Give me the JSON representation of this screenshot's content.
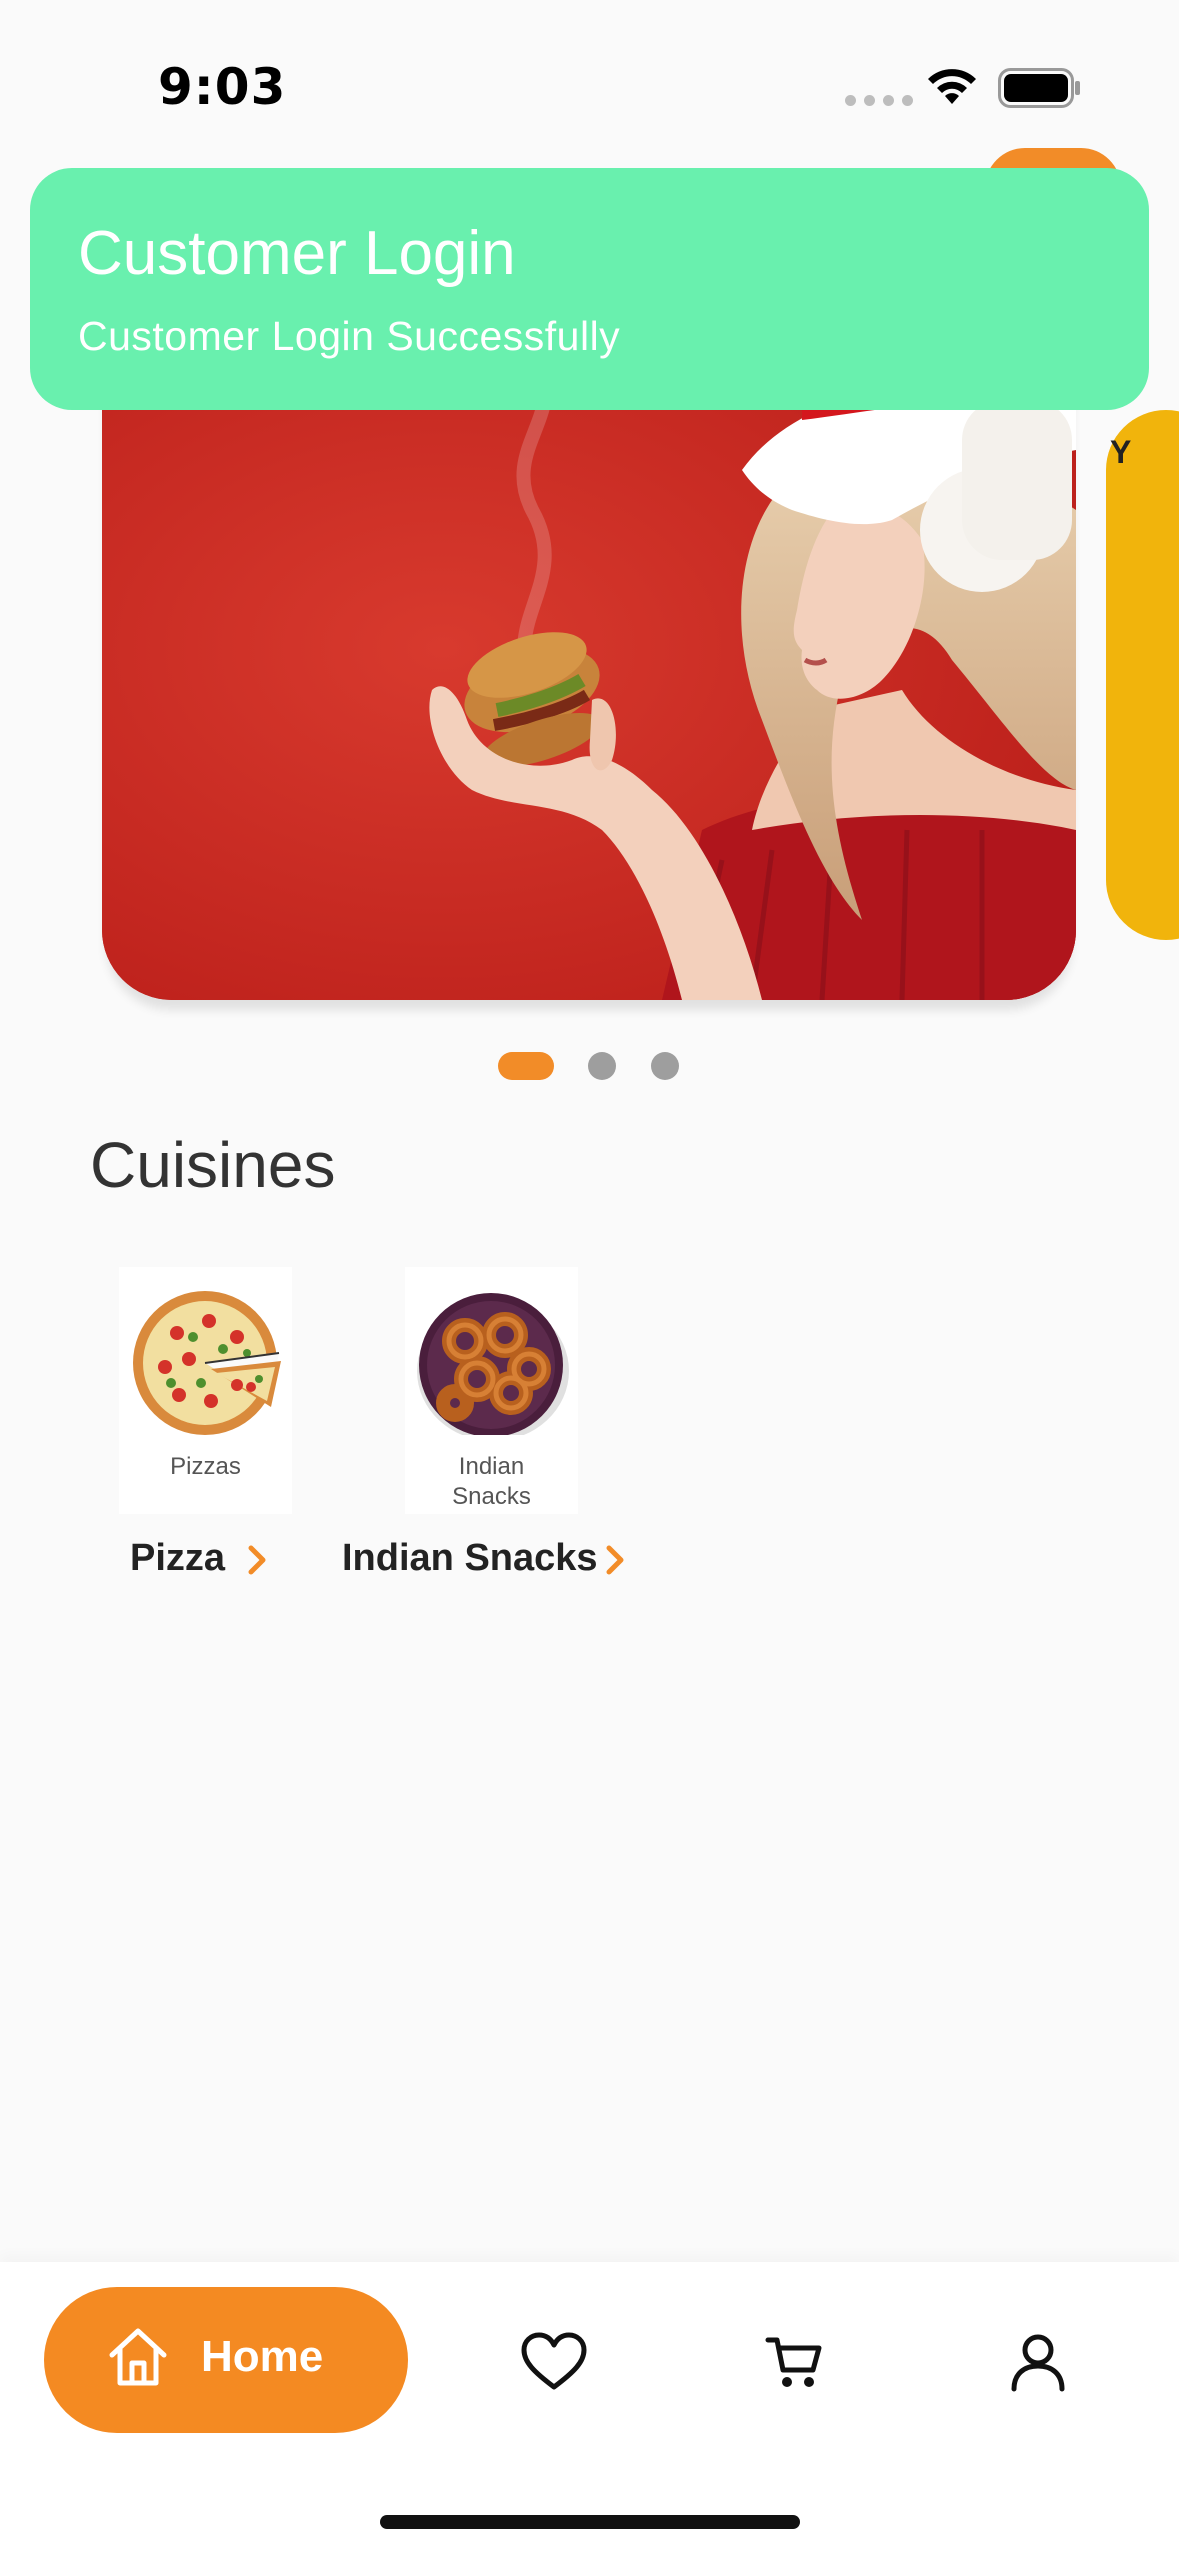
{
  "status_bar": {
    "time": "9:03"
  },
  "toast": {
    "title": "Customer Login",
    "message": "Customer Login Successfully"
  },
  "banner": {
    "next_card_text": "Y",
    "active_index": 0,
    "count": 3
  },
  "cuisines": {
    "title": "Cuisines",
    "items": [
      {
        "card_label": "Pizzas",
        "name": "Pizza"
      },
      {
        "card_label": "Indian Snacks",
        "name": "Indian Snacks"
      }
    ]
  },
  "bottom_nav": {
    "home_label": "Home",
    "items": [
      "home-icon",
      "heart-icon",
      "cart-icon",
      "user-icon"
    ]
  },
  "colors": {
    "accent": "#f28c28",
    "toast_bg": "#69f0ae",
    "banner_bg": "#c7251f"
  }
}
